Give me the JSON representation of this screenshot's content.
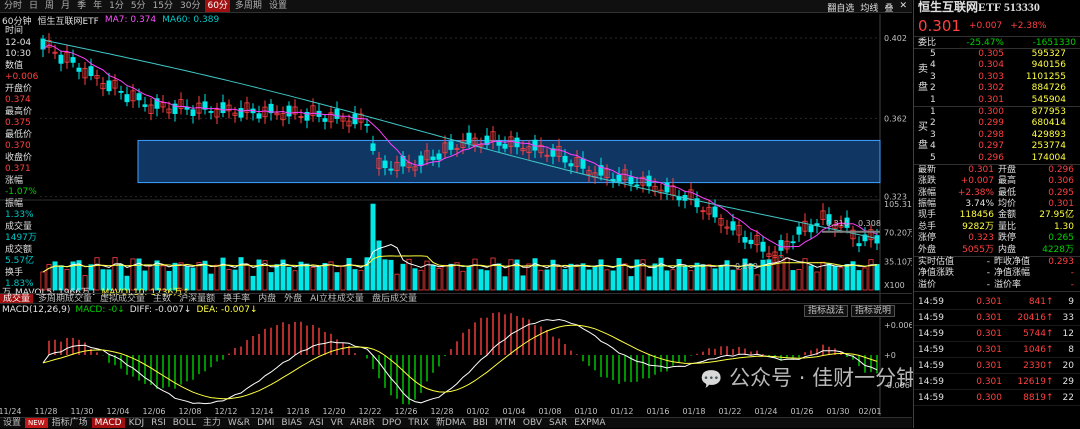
{
  "top_tabs": [
    "分时",
    "日",
    "周",
    "月",
    "季",
    "年",
    "1分",
    "5分",
    "15分",
    "30分",
    "60分",
    "多周期",
    "设置"
  ],
  "top_right": [
    "翻自选",
    "均线",
    "叠",
    "✕"
  ],
  "info": {
    "period": "60分钟",
    "ticker": "恒生互联网ETF",
    "ma7": "MA7: 0.374",
    "ma60": "MA60: 0.389"
  },
  "left_panel": [
    {
      "k": "时间",
      "c": "white"
    },
    {
      "k": "12-04",
      "c": "white"
    },
    {
      "k": "10:30",
      "c": "white"
    },
    {
      "k": "数值",
      "c": "white"
    },
    {
      "k": "+0.006",
      "c": "red"
    },
    {
      "k": "开盘价",
      "c": "white"
    },
    {
      "k": "0.374",
      "c": "red"
    },
    {
      "k": "最高价",
      "c": "white"
    },
    {
      "k": "0.375",
      "c": "red"
    },
    {
      "k": "最低价",
      "c": "white"
    },
    {
      "k": "0.370",
      "c": "red"
    },
    {
      "k": "收盘价",
      "c": "white"
    },
    {
      "k": "0.371",
      "c": "red"
    },
    {
      "k": "涨幅",
      "c": "white"
    },
    {
      "k": "-1.07%",
      "c": "green"
    },
    {
      "k": "振幅",
      "c": "white"
    },
    {
      "k": "1.33%",
      "c": "cyan"
    },
    {
      "k": "成交量",
      "c": "white"
    },
    {
      "k": "1497万",
      "c": "cyan"
    },
    {
      "k": "成交额",
      "c": "white"
    },
    {
      "k": "5.57亿",
      "c": "cyan"
    },
    {
      "k": "换手",
      "c": "white"
    },
    {
      "k": "1.83%",
      "c": "cyan"
    }
  ],
  "price_axis": [
    "0.402",
    "0.362",
    "0.323"
  ],
  "vol_axis": [
    "105.31万",
    "70.20万",
    "35.10万",
    "X100"
  ],
  "macd_axis": [
    "+0.006",
    "+0",
    "-0.006"
  ],
  "annotations": {
    "low": "0.289",
    "marker": "0.310",
    "ma_label": "0.308"
  },
  "vol_info": {
    "prefix": "万",
    "mavol5": "MAVOL5: 1966万↓",
    "mavol10": "MAVOL10: 1736万↑"
  },
  "vol_tabs": [
    "成交量",
    "多周期成交量",
    "虚拟成交量",
    "主数",
    "沪深量额",
    "换手率",
    "内盘",
    "外盘",
    "AI立柱成交量",
    "盘后成交量"
  ],
  "macd_info": {
    "name": "MACD(12,26,9)",
    "macd": "MACD: -0↓",
    "diff": "DIFF: -0.007↓",
    "dea": "DEA: -0.007↓"
  },
  "macd_buttons": [
    "指标战法",
    "指标说明"
  ],
  "dates": [
    "11/24",
    "11/28",
    "11/30",
    "12/04",
    "12/06",
    "12/08",
    "12/12",
    "12/14",
    "12/18",
    "12/20",
    "12/22",
    "12/26",
    "12/28",
    "01/02",
    "01/04",
    "01/08",
    "01/10",
    "01/12",
    "01/16",
    "01/18",
    "01/22",
    "01/24",
    "01/26",
    "01/30",
    "02/01"
  ],
  "bottom_tabs": [
    "设置",
    "NEW",
    "指标广场",
    "MACD",
    "KDJ",
    "RSI",
    "BOLL",
    "主力",
    "W&R",
    "DMI",
    "BIAS",
    "ASI",
    "VR",
    "ARBR",
    "DPO",
    "TRIX",
    "新DMA",
    "BBI",
    "MTM",
    "OBV",
    "SAR",
    "EXPMA"
  ],
  "watermark": "公众号 · 佳财一分钟",
  "quote": {
    "title": "恒生互联网ETF 513330",
    "price": "0.301",
    "change": "+0.007",
    "pct": "+2.38%",
    "ratio_label": "委比",
    "ratio": "-25.47%",
    "ratio_diff": "-1651330"
  },
  "asks": [
    {
      "n": "5",
      "p": "0.305",
      "v": "595327"
    },
    {
      "n": "4",
      "p": "0.304",
      "v": "940156"
    },
    {
      "n": "3",
      "p": "0.303",
      "v": "1101255"
    },
    {
      "n": "2",
      "p": "0.302",
      "v": "884726"
    },
    {
      "n": "1",
      "p": "0.301",
      "v": "545904"
    }
  ],
  "bids": [
    {
      "n": "1",
      "p": "0.300",
      "v": "877953"
    },
    {
      "n": "2",
      "p": "0.299",
      "v": "680414"
    },
    {
      "n": "3",
      "p": "0.298",
      "v": "429893"
    },
    {
      "n": "4",
      "p": "0.297",
      "v": "253774"
    },
    {
      "n": "5",
      "p": "0.296",
      "v": "174004"
    }
  ],
  "ask_side": [
    "卖",
    "盘"
  ],
  "bid_side": [
    "买",
    "盘"
  ],
  "stats": [
    [
      "最新",
      "0.301",
      "red",
      "开盘",
      "0.296",
      "red"
    ],
    [
      "涨跌",
      "+0.007",
      "red",
      "最高",
      "0.306",
      "red"
    ],
    [
      "涨幅",
      "+2.38%",
      "red",
      "最低",
      "0.295",
      "red"
    ],
    [
      "振幅",
      "3.74%",
      "white",
      "均价",
      "0.301",
      "red"
    ],
    [
      "现手",
      "118456",
      "yellow",
      "金额",
      "27.95亿",
      "yellow"
    ],
    [
      "总手",
      "9282万",
      "yellow",
      "量比",
      "1.30",
      "yellow"
    ],
    [
      "涨停",
      "0.323",
      "red",
      "跌停",
      "0.265",
      "green"
    ],
    [
      "外盘",
      "5055万",
      "red",
      "内盘",
      "4228万",
      "green"
    ]
  ],
  "nav": [
    [
      "实时估值",
      "-",
      "昨收净值",
      "0.293"
    ],
    [
      "净值涨跌",
      "-",
      "净值涨幅",
      "-"
    ],
    [
      "溢价",
      "-",
      "溢价率",
      "-"
    ]
  ],
  "ticks": [
    {
      "t": "14:59",
      "p": "0.301",
      "v": "841",
      "d": "9"
    },
    {
      "t": "14:59",
      "p": "0.301",
      "v": "20416",
      "d": "33"
    },
    {
      "t": "14:59",
      "p": "0.301",
      "v": "5744",
      "d": "12"
    },
    {
      "t": "14:59",
      "p": "0.301",
      "v": "1046",
      "d": "8"
    },
    {
      "t": "14:59",
      "p": "0.301",
      "v": "2330",
      "d": "20"
    },
    {
      "t": "14:59",
      "p": "0.301",
      "v": "12619",
      "d": "29"
    },
    {
      "t": "14:59",
      "p": "0.300",
      "v": "8819",
      "d": "22"
    }
  ],
  "colors": {
    "up": "#ff4040",
    "down": "#00e8e8",
    "ma7": "#ff40ff",
    "ma60": "#40c8c8",
    "box": "#1e64b4"
  }
}
